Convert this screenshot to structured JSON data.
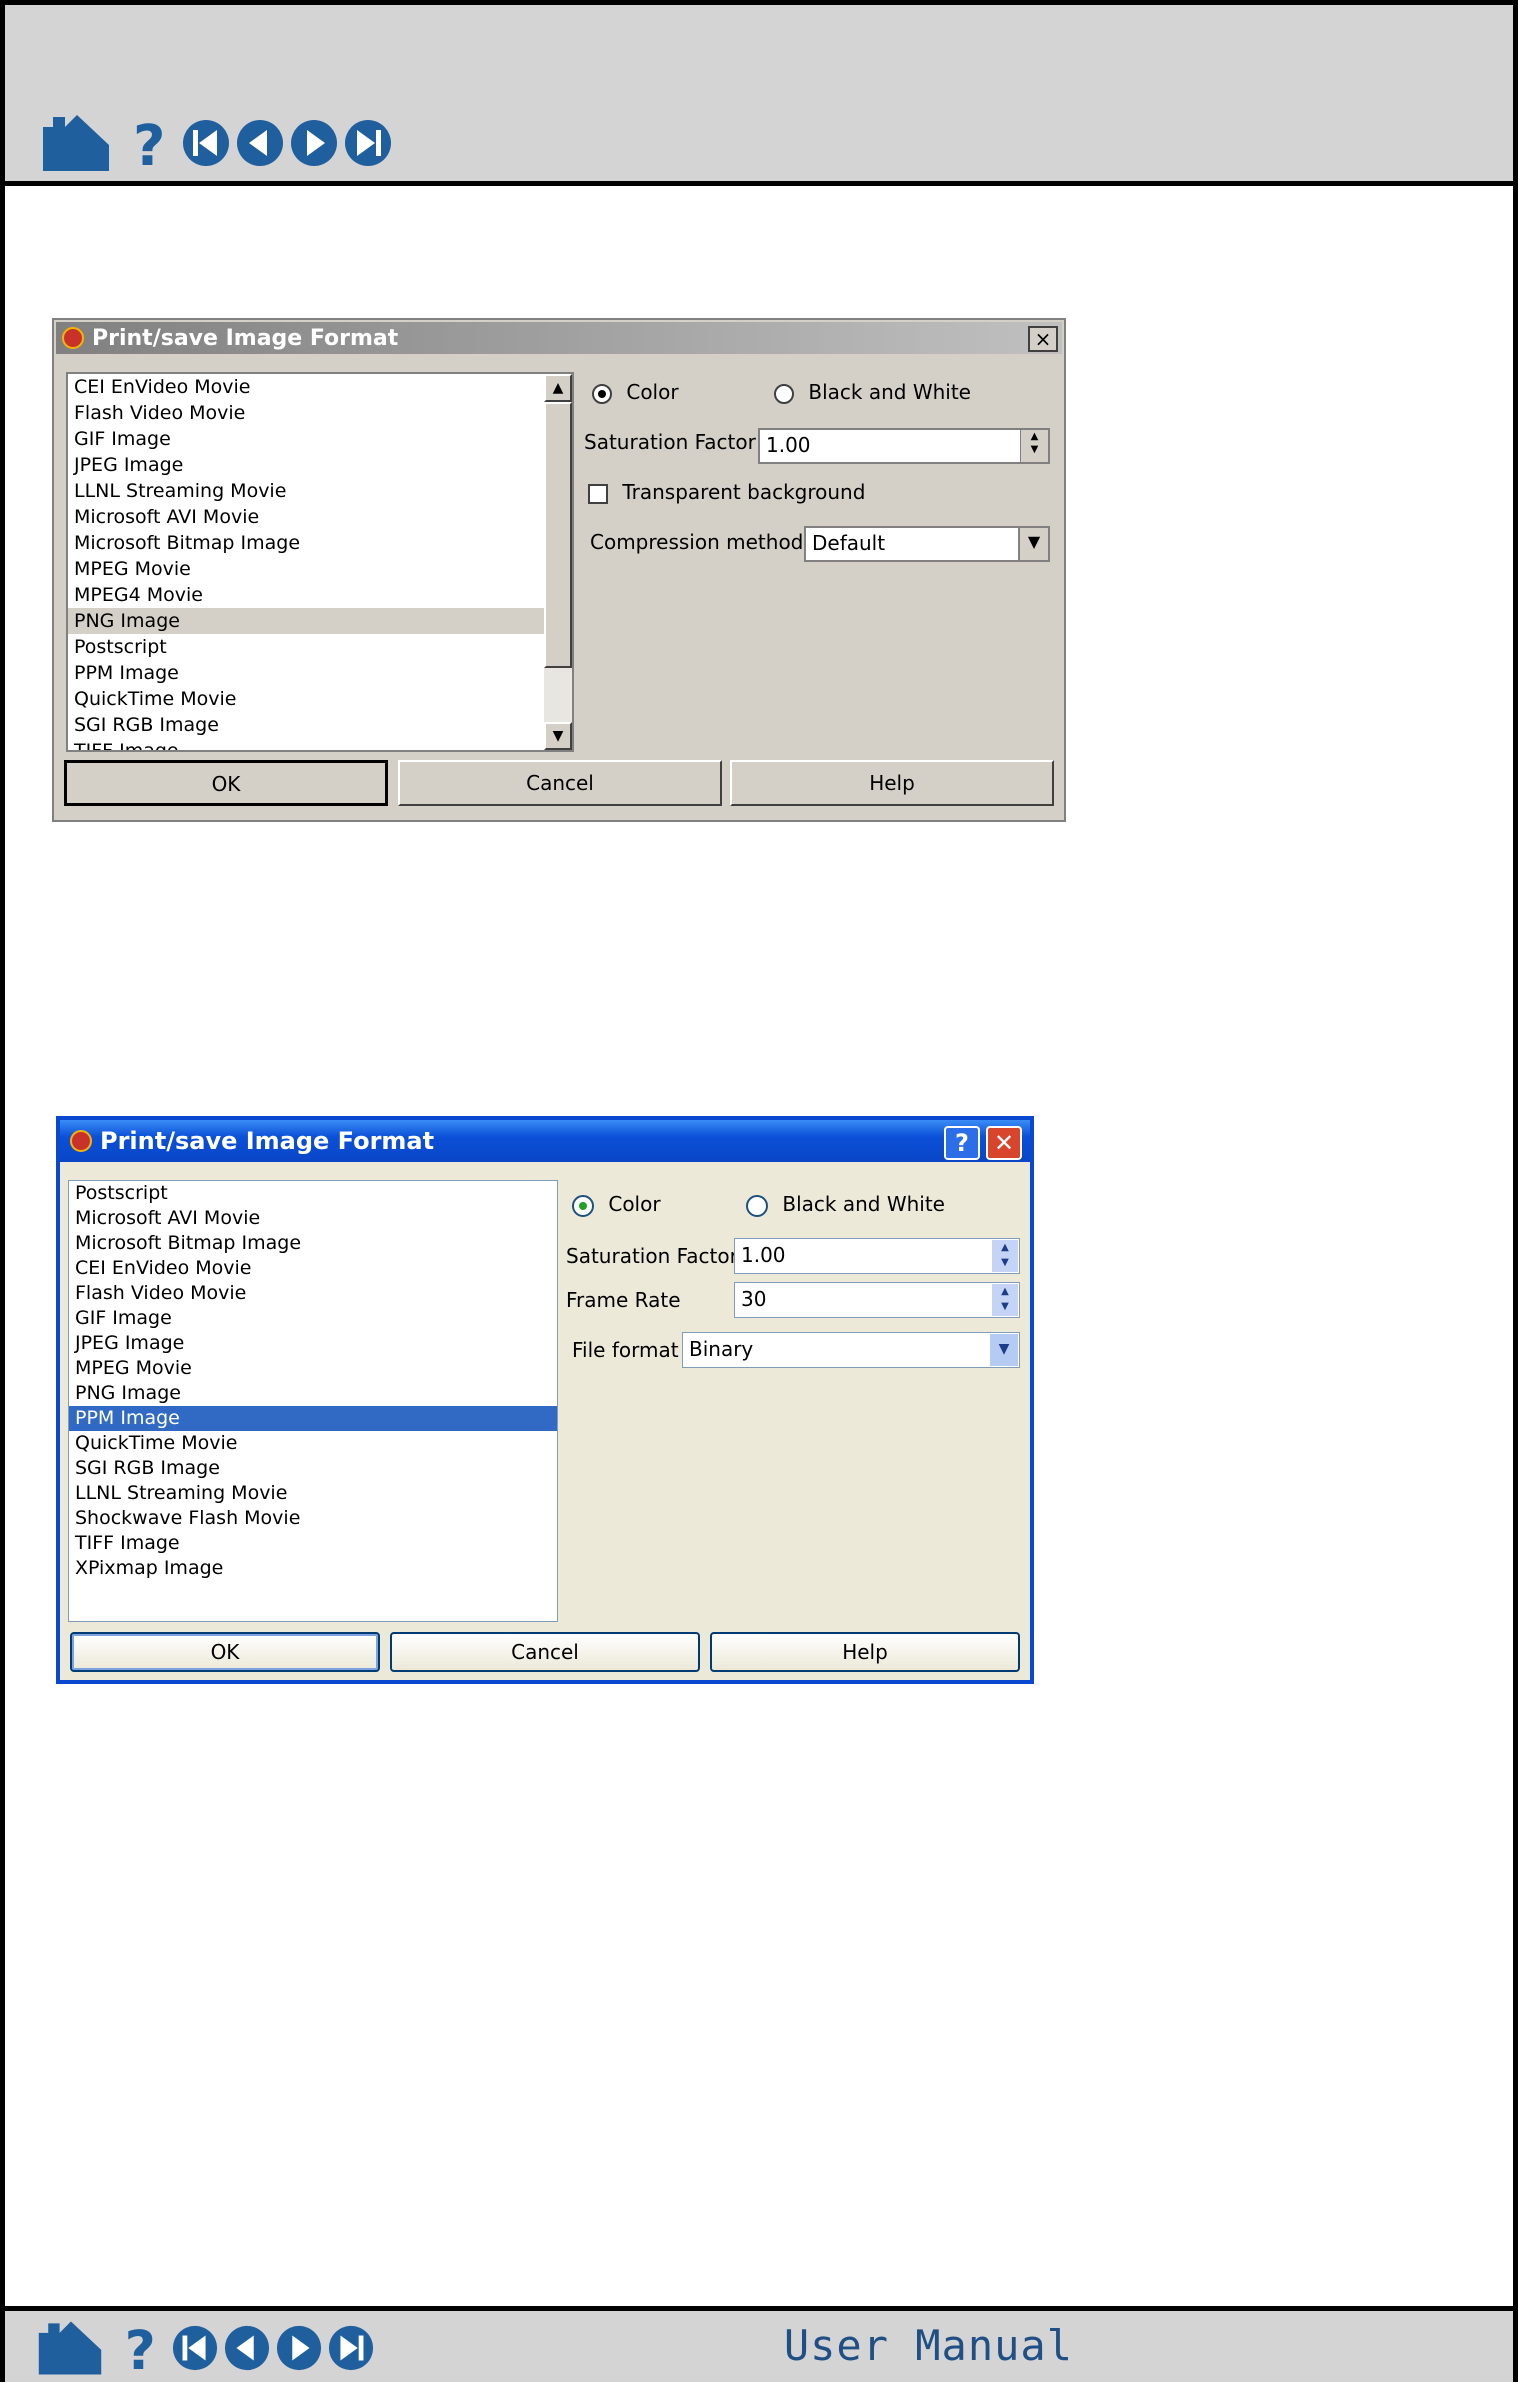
{
  "brand": "User Manual",
  "dialog1": {
    "title": "Print/save Image Format",
    "close_label": "×",
    "formats": [
      "CEI EnVideo Movie",
      "Flash Video Movie",
      "GIF Image",
      "JPEG Image",
      "LLNL Streaming Movie",
      "Microsoft AVI Movie",
      "Microsoft Bitmap Image",
      "MPEG Movie",
      "MPEG4 Movie",
      "PNG Image",
      "Postscript",
      "PPM Image",
      "QuickTime Movie",
      "SGI RGB Image",
      "TIFF Image"
    ],
    "selected_format": "PNG Image",
    "color_label": "Color",
    "bw_label": "Black and White",
    "saturation_label": "Saturation Factor",
    "saturation_value": "1.00",
    "transparent_label": "Transparent background",
    "compression_label": "Compression method",
    "compression_value": "Default",
    "ok_label": "OK",
    "cancel_label": "Cancel",
    "help_label": "Help"
  },
  "dialog2": {
    "title": "Print/save Image Format",
    "help_btn": "?",
    "close_btn": "✕",
    "formats": [
      "Postscript",
      "Microsoft AVI Movie",
      "Microsoft Bitmap Image",
      "CEI EnVideo Movie",
      "Flash Video Movie",
      "GIF Image",
      "JPEG Image",
      "MPEG Movie",
      "PNG Image",
      "PPM Image",
      "QuickTime Movie",
      "SGI RGB Image",
      "LLNL Streaming Movie",
      "Shockwave Flash Movie",
      "TIFF Image",
      "XPixmap Image"
    ],
    "selected_format": "PPM Image",
    "color_label": "Color",
    "bw_label": "Black and White",
    "saturation_label": "Saturation Factor",
    "saturation_value": "1.00",
    "framerate_label": "Frame Rate",
    "framerate_value": "30",
    "fileformat_label": "File format",
    "fileformat_value": "Binary",
    "ok_label": "OK",
    "cancel_label": "Cancel",
    "help_label": "Help"
  }
}
